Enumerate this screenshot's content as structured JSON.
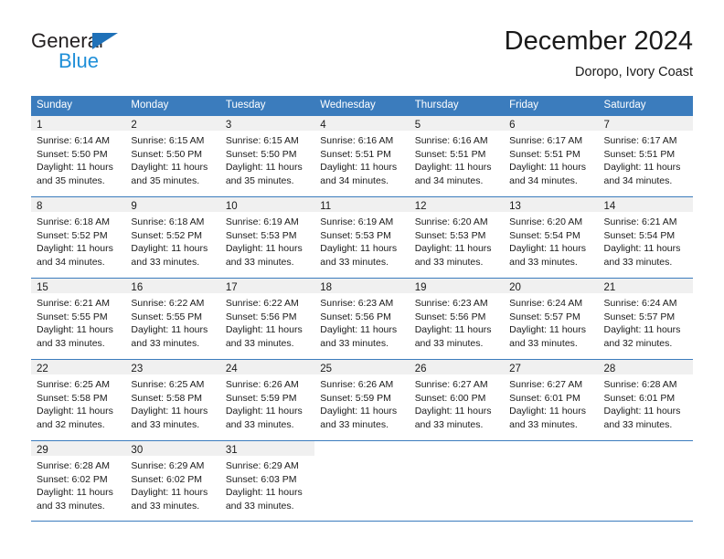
{
  "brand": {
    "name_part1": "General",
    "name_part2": "Blue",
    "triangle_icon": "triangle-icon",
    "color_dark": "#231f20",
    "color_blue": "#1f8fd8"
  },
  "header": {
    "title": "December 2024",
    "subtitle": "Doropo, Ivory Coast"
  },
  "theme": {
    "header_blue": "#3b7cbd",
    "day_band_gray": "#f0f0f0",
    "text": "#1a1a1a"
  },
  "calendar": {
    "weekdays": [
      "Sunday",
      "Monday",
      "Tuesday",
      "Wednesday",
      "Thursday",
      "Friday",
      "Saturday"
    ],
    "weeks": [
      [
        {
          "day": "1",
          "sunrise": "Sunrise: 6:14 AM",
          "sunset": "Sunset: 5:50 PM",
          "daylight1": "Daylight: 11 hours",
          "daylight2": "and 35 minutes."
        },
        {
          "day": "2",
          "sunrise": "Sunrise: 6:15 AM",
          "sunset": "Sunset: 5:50 PM",
          "daylight1": "Daylight: 11 hours",
          "daylight2": "and 35 minutes."
        },
        {
          "day": "3",
          "sunrise": "Sunrise: 6:15 AM",
          "sunset": "Sunset: 5:50 PM",
          "daylight1": "Daylight: 11 hours",
          "daylight2": "and 35 minutes."
        },
        {
          "day": "4",
          "sunrise": "Sunrise: 6:16 AM",
          "sunset": "Sunset: 5:51 PM",
          "daylight1": "Daylight: 11 hours",
          "daylight2": "and 34 minutes."
        },
        {
          "day": "5",
          "sunrise": "Sunrise: 6:16 AM",
          "sunset": "Sunset: 5:51 PM",
          "daylight1": "Daylight: 11 hours",
          "daylight2": "and 34 minutes."
        },
        {
          "day": "6",
          "sunrise": "Sunrise: 6:17 AM",
          "sunset": "Sunset: 5:51 PM",
          "daylight1": "Daylight: 11 hours",
          "daylight2": "and 34 minutes."
        },
        {
          "day": "7",
          "sunrise": "Sunrise: 6:17 AM",
          "sunset": "Sunset: 5:51 PM",
          "daylight1": "Daylight: 11 hours",
          "daylight2": "and 34 minutes."
        }
      ],
      [
        {
          "day": "8",
          "sunrise": "Sunrise: 6:18 AM",
          "sunset": "Sunset: 5:52 PM",
          "daylight1": "Daylight: 11 hours",
          "daylight2": "and 34 minutes."
        },
        {
          "day": "9",
          "sunrise": "Sunrise: 6:18 AM",
          "sunset": "Sunset: 5:52 PM",
          "daylight1": "Daylight: 11 hours",
          "daylight2": "and 33 minutes."
        },
        {
          "day": "10",
          "sunrise": "Sunrise: 6:19 AM",
          "sunset": "Sunset: 5:53 PM",
          "daylight1": "Daylight: 11 hours",
          "daylight2": "and 33 minutes."
        },
        {
          "day": "11",
          "sunrise": "Sunrise: 6:19 AM",
          "sunset": "Sunset: 5:53 PM",
          "daylight1": "Daylight: 11 hours",
          "daylight2": "and 33 minutes."
        },
        {
          "day": "12",
          "sunrise": "Sunrise: 6:20 AM",
          "sunset": "Sunset: 5:53 PM",
          "daylight1": "Daylight: 11 hours",
          "daylight2": "and 33 minutes."
        },
        {
          "day": "13",
          "sunrise": "Sunrise: 6:20 AM",
          "sunset": "Sunset: 5:54 PM",
          "daylight1": "Daylight: 11 hours",
          "daylight2": "and 33 minutes."
        },
        {
          "day": "14",
          "sunrise": "Sunrise: 6:21 AM",
          "sunset": "Sunset: 5:54 PM",
          "daylight1": "Daylight: 11 hours",
          "daylight2": "and 33 minutes."
        }
      ],
      [
        {
          "day": "15",
          "sunrise": "Sunrise: 6:21 AM",
          "sunset": "Sunset: 5:55 PM",
          "daylight1": "Daylight: 11 hours",
          "daylight2": "and 33 minutes."
        },
        {
          "day": "16",
          "sunrise": "Sunrise: 6:22 AM",
          "sunset": "Sunset: 5:55 PM",
          "daylight1": "Daylight: 11 hours",
          "daylight2": "and 33 minutes."
        },
        {
          "day": "17",
          "sunrise": "Sunrise: 6:22 AM",
          "sunset": "Sunset: 5:56 PM",
          "daylight1": "Daylight: 11 hours",
          "daylight2": "and 33 minutes."
        },
        {
          "day": "18",
          "sunrise": "Sunrise: 6:23 AM",
          "sunset": "Sunset: 5:56 PM",
          "daylight1": "Daylight: 11 hours",
          "daylight2": "and 33 minutes."
        },
        {
          "day": "19",
          "sunrise": "Sunrise: 6:23 AM",
          "sunset": "Sunset: 5:56 PM",
          "daylight1": "Daylight: 11 hours",
          "daylight2": "and 33 minutes."
        },
        {
          "day": "20",
          "sunrise": "Sunrise: 6:24 AM",
          "sunset": "Sunset: 5:57 PM",
          "daylight1": "Daylight: 11 hours",
          "daylight2": "and 33 minutes."
        },
        {
          "day": "21",
          "sunrise": "Sunrise: 6:24 AM",
          "sunset": "Sunset: 5:57 PM",
          "daylight1": "Daylight: 11 hours",
          "daylight2": "and 32 minutes."
        }
      ],
      [
        {
          "day": "22",
          "sunrise": "Sunrise: 6:25 AM",
          "sunset": "Sunset: 5:58 PM",
          "daylight1": "Daylight: 11 hours",
          "daylight2": "and 32 minutes."
        },
        {
          "day": "23",
          "sunrise": "Sunrise: 6:25 AM",
          "sunset": "Sunset: 5:58 PM",
          "daylight1": "Daylight: 11 hours",
          "daylight2": "and 33 minutes."
        },
        {
          "day": "24",
          "sunrise": "Sunrise: 6:26 AM",
          "sunset": "Sunset: 5:59 PM",
          "daylight1": "Daylight: 11 hours",
          "daylight2": "and 33 minutes."
        },
        {
          "day": "25",
          "sunrise": "Sunrise: 6:26 AM",
          "sunset": "Sunset: 5:59 PM",
          "daylight1": "Daylight: 11 hours",
          "daylight2": "and 33 minutes."
        },
        {
          "day": "26",
          "sunrise": "Sunrise: 6:27 AM",
          "sunset": "Sunset: 6:00 PM",
          "daylight1": "Daylight: 11 hours",
          "daylight2": "and 33 minutes."
        },
        {
          "day": "27",
          "sunrise": "Sunrise: 6:27 AM",
          "sunset": "Sunset: 6:01 PM",
          "daylight1": "Daylight: 11 hours",
          "daylight2": "and 33 minutes."
        },
        {
          "day": "28",
          "sunrise": "Sunrise: 6:28 AM",
          "sunset": "Sunset: 6:01 PM",
          "daylight1": "Daylight: 11 hours",
          "daylight2": "and 33 minutes."
        }
      ],
      [
        {
          "day": "29",
          "sunrise": "Sunrise: 6:28 AM",
          "sunset": "Sunset: 6:02 PM",
          "daylight1": "Daylight: 11 hours",
          "daylight2": "and 33 minutes."
        },
        {
          "day": "30",
          "sunrise": "Sunrise: 6:29 AM",
          "sunset": "Sunset: 6:02 PM",
          "daylight1": "Daylight: 11 hours",
          "daylight2": "and 33 minutes."
        },
        {
          "day": "31",
          "sunrise": "Sunrise: 6:29 AM",
          "sunset": "Sunset: 6:03 PM",
          "daylight1": "Daylight: 11 hours",
          "daylight2": "and 33 minutes."
        },
        {
          "day": "",
          "sunrise": "",
          "sunset": "",
          "daylight1": "",
          "daylight2": ""
        },
        {
          "day": "",
          "sunrise": "",
          "sunset": "",
          "daylight1": "",
          "daylight2": ""
        },
        {
          "day": "",
          "sunrise": "",
          "sunset": "",
          "daylight1": "",
          "daylight2": ""
        },
        {
          "day": "",
          "sunrise": "",
          "sunset": "",
          "daylight1": "",
          "daylight2": ""
        }
      ]
    ]
  }
}
